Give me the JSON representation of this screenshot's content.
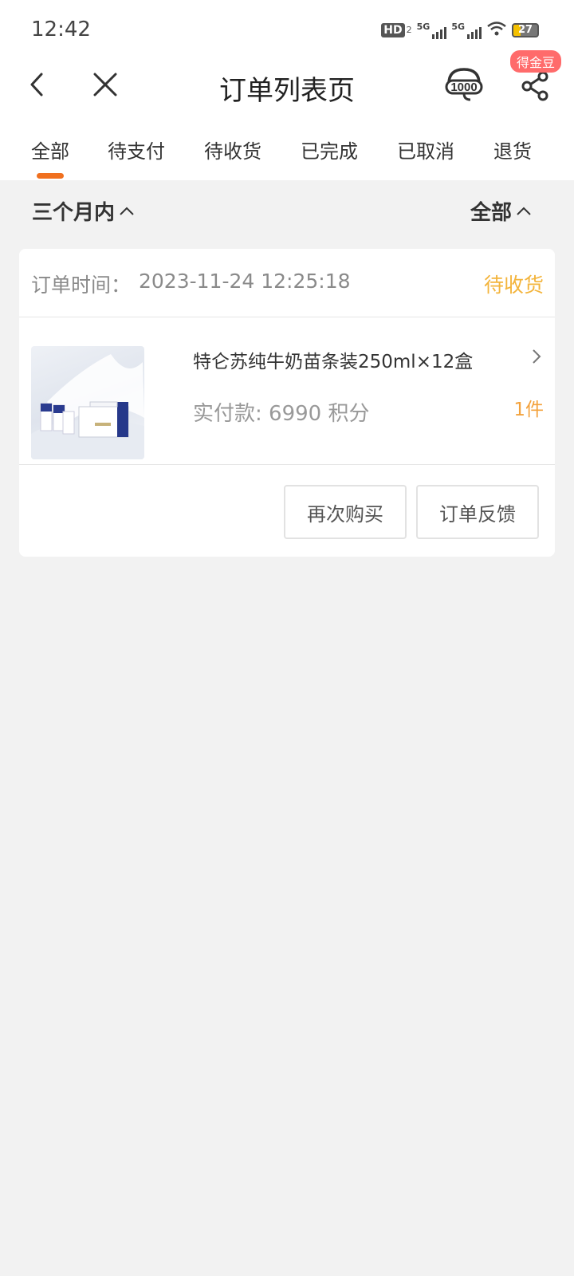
{
  "status_bar": {
    "time": "12:42",
    "hd_label": "HD",
    "hd_sub": "2",
    "net1_label": "5G",
    "net2_label": "5G",
    "battery": "27"
  },
  "header": {
    "title": "订单列表页",
    "badge": "得金豆",
    "icons": [
      "back-icon",
      "close-icon",
      "customer-service-icon",
      "share-icon"
    ]
  },
  "tabs": [
    {
      "label": "全部",
      "active": true
    },
    {
      "label": "待支付"
    },
    {
      "label": "待收货"
    },
    {
      "label": "已完成"
    },
    {
      "label": "已取消"
    },
    {
      "label": "退货"
    }
  ],
  "filters": {
    "time_range": "三个月内",
    "type": "全部"
  },
  "order": {
    "time_label": "订单时间：",
    "time_value": "2023-11-24 12:25:18",
    "status": "待收货",
    "product_name": "特仑苏纯牛奶苗条装250ml×12盒",
    "paid": "实付款: 6990 积分",
    "quantity": "1件",
    "actions": {
      "rebuy": "再次购买",
      "feedback": "订单反馈"
    }
  },
  "colors": {
    "accent": "#f0701f",
    "status": "#f3b43c",
    "quantity": "#f3a23c",
    "badge": "#ff6b6b"
  }
}
